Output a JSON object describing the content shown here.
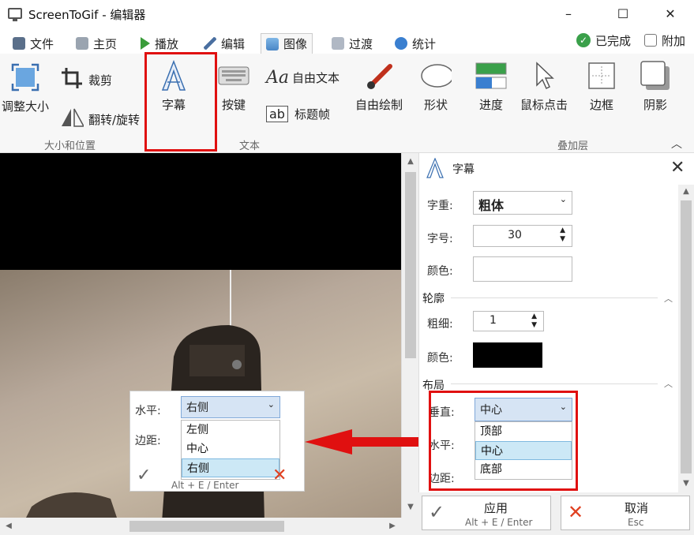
{
  "window": {
    "title": "ScreenToGif - 编辑器",
    "minimize_label": "–",
    "maximize_label": "☐",
    "close_label": "✕"
  },
  "tabs": [
    {
      "label": "文件"
    },
    {
      "label": "主页"
    },
    {
      "label": "播放"
    },
    {
      "label": "编辑"
    },
    {
      "label": "图像"
    },
    {
      "label": "过渡"
    },
    {
      "label": "统计"
    }
  ],
  "status": {
    "done_label": "已完成",
    "attach_label": "附加"
  },
  "ribbon": {
    "resize_label": "调整大小",
    "crop_label": "裁剪",
    "flip_rotate_label": "翻转/旋转",
    "size_group_label": "大小和位置",
    "caption_label": "字幕",
    "key_label": "按键",
    "free_text_label": "自由文本",
    "title_frame_label": "标题帧",
    "text_group_label": "文本",
    "free_draw_label": "自由绘制",
    "shape_label": "形状",
    "progress_label": "进度",
    "mouse_click_label": "鼠标点击",
    "border_label": "边框",
    "shadow_label": "阴影",
    "overlay_group_label": "叠加层",
    "free_text_glyph": "Aa",
    "title_frame_glyph": "ab"
  },
  "panel": {
    "title": "字幕",
    "font_weight_label": "字重:",
    "font_weight_value": "粗体",
    "font_size_label": "字号:",
    "font_size_value": "30",
    "color_label": "颜色:",
    "outline_section": "轮廓",
    "thickness_label": "粗细:",
    "thickness_value": "1",
    "outline_color_label": "颜色:",
    "layout_section": "布局",
    "vertical_label": "垂直:",
    "vertical_value": "中心",
    "horizontal_label": "水平:",
    "margin_label": "边距:",
    "vertical_options": [
      "顶部",
      "中心",
      "底部"
    ]
  },
  "overlay_popup": {
    "horizontal_label": "水平:",
    "horizontal_value": "右侧",
    "margin_label": "边距:",
    "options": [
      "左侧",
      "中心",
      "右侧"
    ],
    "apply_hint": "Alt + E / Enter"
  },
  "footer": {
    "apply_label": "应用",
    "apply_hint": "Alt + E / Enter",
    "cancel_label": "取消",
    "cancel_hint": "Esc"
  },
  "colors": {
    "accent": "#e01010",
    "apply_check": "#666666",
    "cancel_x": "#e04020"
  }
}
